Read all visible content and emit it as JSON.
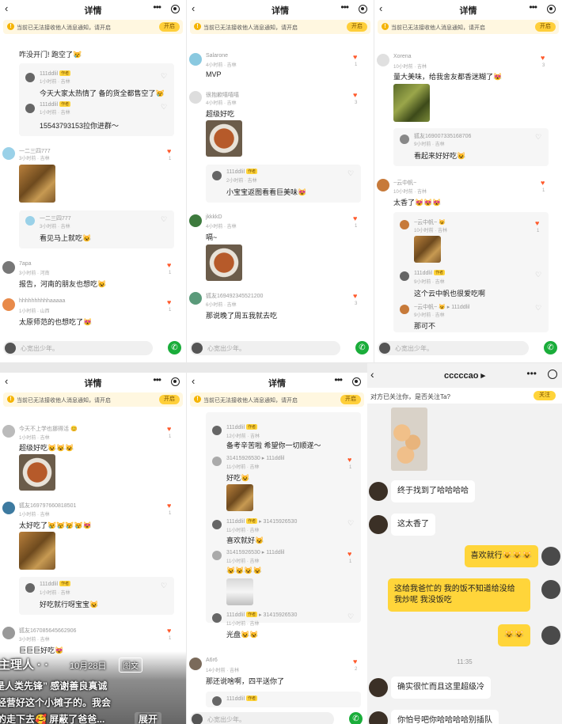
{
  "nav": {
    "title": "详情"
  },
  "notice": {
    "icon": "!",
    "text": "当前已无法接收他人消息通知，请开启",
    "button": "开启"
  },
  "bottom_bar": {
    "placeholder": "心宽出少年。",
    "wx_icon": "✆"
  },
  "panel1": {
    "top_text": "咋没开门! 跑空了😿",
    "reply1": {
      "nick": "111ddlil",
      "tag": "作者",
      "meta": "1小时前 · 吉林",
      "text": "今天大家太热情了 备的货全都售空了😿"
    },
    "reply2": {
      "nick": "111ddlil",
      "tag": "作者",
      "meta": "1小时前 · 吉林",
      "text": "15543793153拉你进群～"
    },
    "c1": {
      "nick": "一二三四777",
      "meta": "3小时前 · 吉林",
      "likes": "1"
    },
    "reply3": {
      "nick": "一二三四777",
      "meta": "3小时前 · 吉林",
      "text": "看见马上就吃😺"
    },
    "c2": {
      "nick": "7apa",
      "meta": "3小时前 · 河南",
      "text": "报告，河南的朋友也想吃😺",
      "likes": "1"
    },
    "c3": {
      "nick": "hhhhhhhhhhaaaaa",
      "meta": "1小时前 · 山西",
      "text": "太原师范的也想吃了😻",
      "likes": "1"
    }
  },
  "panel2": {
    "c1": {
      "nick": "Salarone",
      "meta": "4小时前 · 吉林",
      "text": "MVP",
      "likes": "1"
    },
    "c2": {
      "nick": "很抱歉嘻嘻嘻",
      "meta": "4小时前 · 吉林",
      "text": "超级好吃",
      "likes": "3"
    },
    "reply1": {
      "nick": "111ddlil",
      "tag": "作者",
      "meta": "2小时前 · 吉林",
      "text": "小宝宝返图看看巨美味😻"
    },
    "c3": {
      "nick": "jkkkkD",
      "meta": "4小时前 · 吉林",
      "text": "嗝~",
      "likes": "1"
    },
    "c4": {
      "nick": "狐友169492345521200",
      "meta": "6小时前 · 吉林",
      "text": "那说晚了周五我就去吃",
      "likes": "3"
    }
  },
  "panel3": {
    "c1": {
      "nick": "Xorena",
      "meta": "10小时前 · 吉林",
      "text": "量大美味，给我舍友都香迷糊了😻",
      "likes": "3"
    },
    "reply1": {
      "nick": "狐友169007335168706",
      "meta": "9小时前 · 吉林",
      "text": "看起来好好吃😺"
    },
    "c2": {
      "nick": "~云中帆~",
      "meta": "10小时前 · 吉林",
      "text": "太香了😻😻😻",
      "likes": "1"
    },
    "reply2": {
      "nick": "~云中帆~ 😺",
      "meta": "10小时前 · 吉林",
      "likes": "1"
    },
    "reply3": {
      "nick": "111ddlil",
      "tag": "作者",
      "meta": "9小时前 · 吉林",
      "text": "这个云中帆也很爱吃啊"
    },
    "reply4": {
      "nick": "~云中帆~ 😺 ▸ 111ddlil",
      "meta": "9小时前 · 吉林",
      "text": "那可不"
    }
  },
  "panel4": {
    "c1": {
      "nick": "今天不上学也挪得活 😊",
      "meta": "1小时前 · 吉林",
      "text": "超级好吃😺😺😺",
      "likes": "1"
    },
    "c2": {
      "nick": "狐友169797660818501",
      "meta": "1小时前 · 吉林",
      "text": "太好吃了😿😿😿😿😻",
      "likes": "1"
    },
    "reply1": {
      "nick": "111ddlil",
      "tag": "作者",
      "meta": "1小时前 · 吉林",
      "text": "好吃就行呀宝宝😺"
    },
    "c3": {
      "nick": "狐友167085645662906",
      "meta": "3小时前 · 吉林",
      "text": "巨巨巨好吃😻",
      "likes": "1"
    },
    "overlay": {
      "author": "主理人 · ·",
      "date": "10月28日",
      "note": "图文",
      "line1": "是人类先锋” 感谢善良真诚",
      "line2": "经营好这个小摊子的。我会",
      "line3": "的走下去🥰 屏蔽了爸爸...",
      "expand": "展开"
    }
  },
  "panel5": {
    "r1": {
      "nick": "111ddlil",
      "tag": "作者",
      "meta": "12小时前 · 吉林",
      "text": "备考辛苦啦 希望你一切顺遂～"
    },
    "r2": {
      "nick": "31415926530 ▸ 111ddlil",
      "meta": "11小时前 · 吉林",
      "text": "好吃😺",
      "likes": "1"
    },
    "r3": {
      "nick": "111ddlil",
      "tag": "作者",
      "extra": "▸ 31415926530",
      "meta": "11小时前 · 吉林",
      "text": "喜欢就好😺"
    },
    "r4": {
      "nick": "31415926530 ▸ 111ddlil",
      "meta": "11小时前 · 吉林",
      "text": "😺😺😺😺",
      "likes": "1"
    },
    "r5": {
      "nick": "111ddlil",
      "tag": "作者",
      "extra": "▸ 31415926530",
      "meta": "11小时前 · 吉林",
      "text": "光盘😺😺"
    },
    "c1": {
      "nick": "A6r6",
      "meta": "14小时前 · 吉林",
      "text": "那还说啥啊，四平送你了",
      "likes": "2"
    },
    "r6": {
      "nick": "111ddlil",
      "tag": "作者"
    }
  },
  "panel6": {
    "title": "cccccao ▸",
    "follow_text": "对方已关注你，是否关注Ta?",
    "follow_button": "关注",
    "msg1": "终于找到了哈哈哈哈",
    "msg2": "这太香了",
    "msg3": "喜欢就行😺😺😺",
    "msg4a": "这给我爸忙的 我的饭不知道给没给",
    "msg4b": "我炒呢 我没饭吃",
    "msg5": "😺😺",
    "time": "11:35",
    "msg6": "确实很忙而且这里超级冷",
    "msg7": "你怕号吧你哈哈哈哈别插队"
  }
}
